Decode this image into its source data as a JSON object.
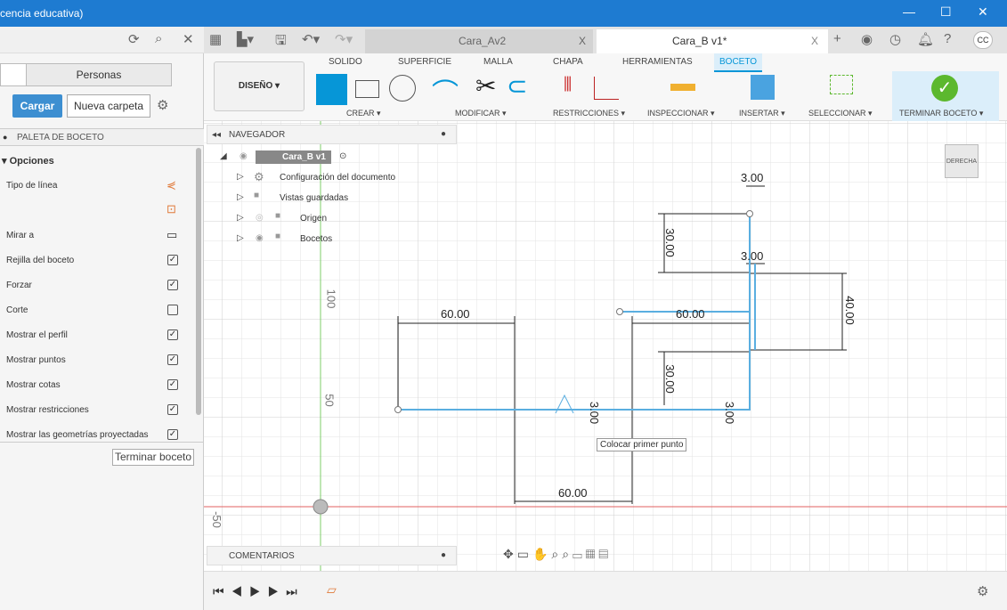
{
  "window": {
    "title": "cencia educativa)",
    "minimize": "—",
    "maximize": "☐",
    "close": "✕"
  },
  "tabs": [
    {
      "label": "Cara_Av2",
      "close": "X"
    },
    {
      "label": "Cara_B v1*",
      "close": "X"
    }
  ],
  "user_initials": "CC",
  "ribbon": {
    "workspace": "DISEÑO ▾",
    "tabs": [
      "SOLIDO",
      "SUPERFICIE",
      "MALLA",
      "CHAPA",
      "HERRAMIENTAS",
      "BOCETO"
    ],
    "active_tab": "BOCETO",
    "groups": [
      "CREAR ▾",
      "MODIFICAR ▾",
      "RESTRICCIONES ▾",
      "INSPECCIONAR ▾",
      "INSERTAR ▾",
      "SELECCIONAR ▾",
      "TERMINAR BOCETO ▾"
    ]
  },
  "left": {
    "personas": "Personas",
    "cargar": "Cargar",
    "nueva_carpeta": "Nueva carpeta",
    "palette_title": "PALETA DE BOCETO",
    "options_header": "▾ Opciones",
    "options": [
      {
        "label": "Tipo de línea"
      },
      {
        "label": "Mirar a"
      },
      {
        "label": "Rejilla del boceto",
        "checked": true
      },
      {
        "label": "Forzar",
        "checked": true
      },
      {
        "label": "Corte",
        "checked": false
      },
      {
        "label": "Mostrar el perfil",
        "checked": true
      },
      {
        "label": "Mostrar puntos",
        "checked": true
      },
      {
        "label": "Mostrar cotas",
        "checked": true
      },
      {
        "label": "Mostrar restricciones",
        "checked": true
      },
      {
        "label": "Mostrar las geometrías proyectadas",
        "checked": true
      }
    ],
    "finish": "Terminar boceto"
  },
  "navigator": {
    "title": "NAVEGADOR",
    "root": "Cara_B v1",
    "items": [
      "Configuración del documento",
      "Vistas guardadas",
      "Origen",
      "Bocetos"
    ]
  },
  "comments": "COMENTARIOS",
  "viewcube": "DERECHA",
  "axis_labels": [
    "100",
    "50",
    "-50"
  ],
  "dimensions": [
    "60.00",
    "60.00",
    "60.00",
    "30.00",
    "30.00",
    "40.00",
    "3.00",
    "3.00",
    "3.00",
    "3.00"
  ],
  "tooltip": "Colocar primer punto",
  "colors": {
    "titlebar": "#1e7bd1",
    "sketch": "#5aaee0",
    "accent": "#0696d7",
    "finish": "#5cb82e"
  }
}
